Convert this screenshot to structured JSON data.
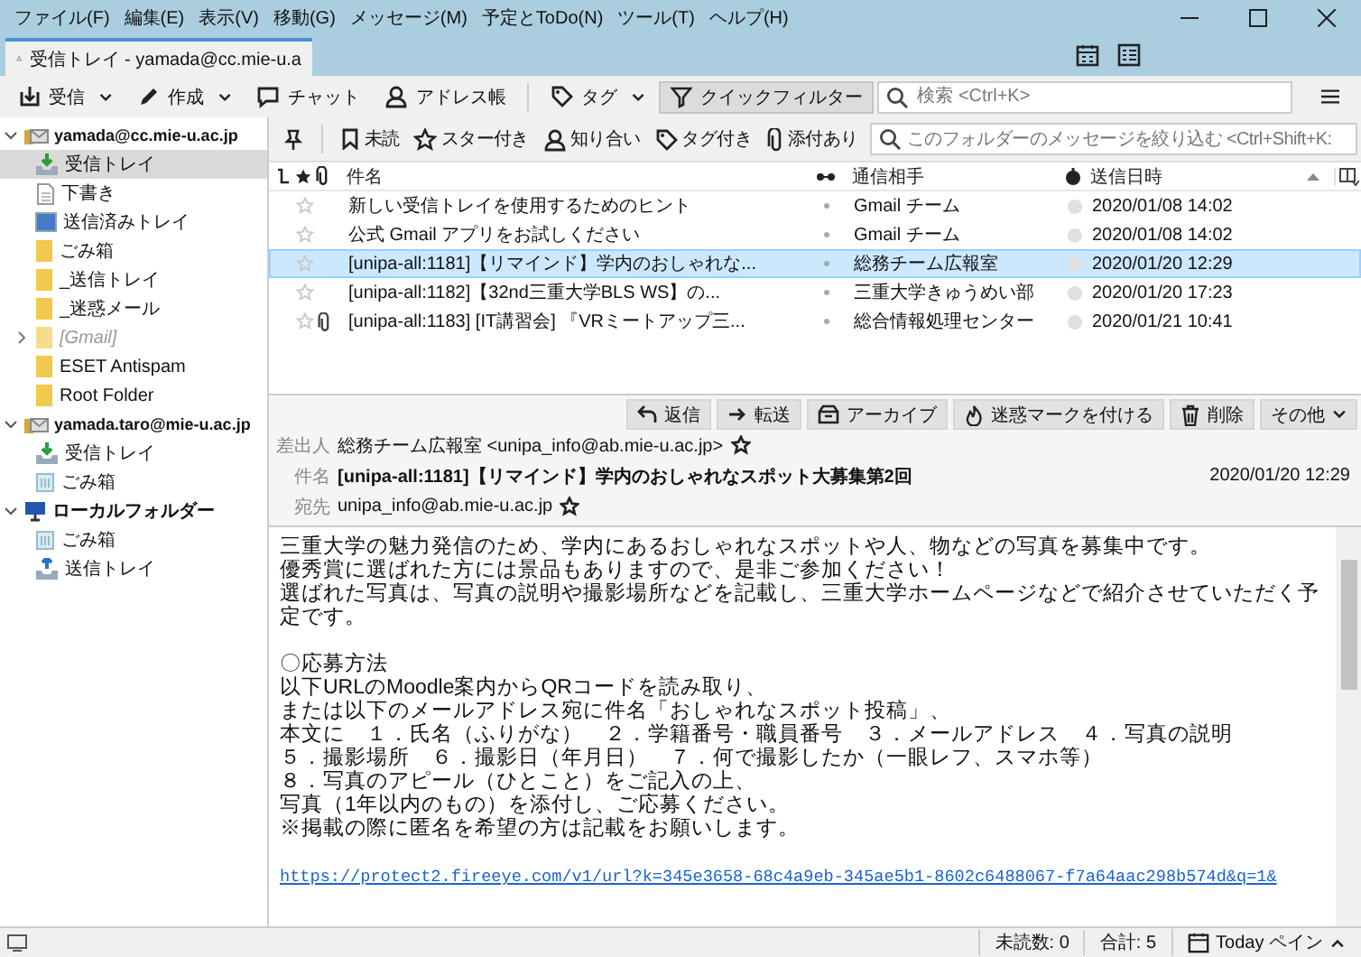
{
  "menu": [
    "ファイル(F)",
    "編集(E)",
    "表示(V)",
    "移動(G)",
    "メッセージ(M)",
    "予定とToDo(N)",
    "ツール(T)",
    "ヘルプ(H)"
  ],
  "tab": {
    "title": "受信トレイ - yamada@cc.mie-u.a"
  },
  "toolbar": [
    {
      "label": "受信",
      "dropdown": true,
      "pressed": false
    },
    {
      "label": "作成",
      "dropdown": true,
      "pressed": false
    },
    {
      "label": "チャット",
      "dropdown": false,
      "pressed": false
    },
    {
      "label": "アドレス帳",
      "dropdown": false,
      "pressed": false
    },
    {
      "label": "タグ",
      "dropdown": true,
      "pressed": false
    },
    {
      "label": "クイックフィルター",
      "dropdown": false,
      "pressed": true
    }
  ],
  "search": {
    "placeholder": "検索 <Ctrl+K>"
  },
  "sidebar": {
    "accounts": [
      {
        "name": "yamada@cc.mie-u.ac.jp",
        "kind": "mail",
        "expanded": true,
        "children": [
          {
            "name": "受信トレイ",
            "kind": "inbox",
            "selected": true
          },
          {
            "name": "下書き",
            "kind": "drafts",
            "selected": false
          },
          {
            "name": "送信済みトレイ",
            "kind": "sent",
            "selected": false
          },
          {
            "name": "ごみ箱",
            "kind": "folder",
            "selected": false
          },
          {
            "name": "_送信トレイ",
            "kind": "folder",
            "selected": false
          },
          {
            "name": "_迷惑メール",
            "kind": "folder",
            "selected": false
          },
          {
            "name": "[Gmail]",
            "kind": "collapsed",
            "selected": false
          },
          {
            "name": "ESET Antispam",
            "kind": "folder",
            "selected": false
          },
          {
            "name": "Root Folder",
            "kind": "folder",
            "selected": false
          }
        ]
      },
      {
        "name": "yamada.taro@mie-u.ac.jp",
        "kind": "mail",
        "expanded": true,
        "children": [
          {
            "name": "受信トレイ",
            "kind": "inbox",
            "selected": false
          },
          {
            "name": "ごみ箱",
            "kind": "trash",
            "selected": false
          }
        ]
      },
      {
        "name": "ローカルフォルダー",
        "kind": "local",
        "expanded": true,
        "children": [
          {
            "name": "ごみ箱",
            "kind": "trash",
            "selected": false
          },
          {
            "name": "送信トレイ",
            "kind": "outbox",
            "selected": false
          }
        ]
      }
    ]
  },
  "filter_bar": {
    "buttons": [
      "未読",
      "スター付き",
      "知り合い",
      "タグ付き",
      "添付あり"
    ],
    "placeholder": "このフォルダーのメッセージを絞り込む <Ctrl+Shift+K:"
  },
  "table": {
    "columns": [
      "件名",
      "通信相手",
      "送信日時"
    ],
    "rows": [
      {
        "subject": "新しい受信トレイを使用するためのヒント",
        "from": "Gmail チーム",
        "date": "2020/01/08 14:02",
        "attachment": false,
        "selected": false
      },
      {
        "subject": "公式 Gmail アプリをお試しください",
        "from": "Gmail チーム",
        "date": "2020/01/08 14:02",
        "attachment": false,
        "selected": false
      },
      {
        "subject": "[unipa-all:1181]【リマインド】学内のおしゃれな...",
        "from": "総務チーム広報室",
        "date": "2020/01/20 12:29",
        "attachment": false,
        "selected": true
      },
      {
        "subject": "[unipa-all:1182]【32nd三重大学BLS WS】の...",
        "from": "三重大学きゅうめい部",
        "date": "2020/01/20 17:23",
        "attachment": false,
        "selected": false
      },
      {
        "subject": "[unipa-all:1183] [IT講習会] 『VRミートアップ三...",
        "from": "総合情報処理センター",
        "date": "2020/01/21 10:41",
        "attachment": true,
        "selected": false
      }
    ]
  },
  "message": {
    "from_label": "差出人",
    "from": "総務チーム広報室 <unipa_info@ab.mie-u.ac.jp>",
    "actions": [
      "返信",
      "転送",
      "アーカイブ",
      "迷惑マークを付ける",
      "削除",
      "その他"
    ],
    "subject_label": "件名",
    "subject": "[unipa-all:1181]【リマインド】学内のおしゃれなスポット大募集第2回",
    "date": "2020/01/20 12:29",
    "to_label": "宛先",
    "to": "unipa_info@ab.mie-u.ac.jp",
    "body": [
      [
        "三重大学の魅力発信のため、学内にあるおしゃれなスポットや人、物などの写真を募集中です。",
        "優秀賞に選ばれた方には景品もありますので、是非ご参加ください！",
        "選ばれた写真は、写真の説明や撮影場所などを記載し、三重大学ホームページなどで紹介させていただく予定です。"
      ],
      [
        "〇応募方法",
        "以下URLのMoodle案内からQRコードを読み取り、",
        "または以下のメールアドレス宛に件名「おしゃれなスポット投稿」、",
        "本文に　１．氏名（ふりがな）　２．学籍番号・職員番号　３．メールアドレス　４．写真の説明",
        "５．撮影場所　６．撮影日（年月日）　７．何で撮影したか（一眼レフ、スマホ等）",
        "８．写真のアピール（ひとこと）をご記入の上、",
        "写真（1年以内のもの）を添付し、ご応募ください。",
        "※掲載の際に匿名を希望の方は記載をお願いします。"
      ]
    ],
    "link": "https://protect2.fireeye.com/v1/url?k=345e3658-68c4a9eb-345ae5b1-8602c6488067-f7a64aac298b574d&q=1&"
  },
  "status_bar": {
    "unread": "未読数: 0",
    "total": "合計: 5",
    "today": "Today ペイン"
  }
}
